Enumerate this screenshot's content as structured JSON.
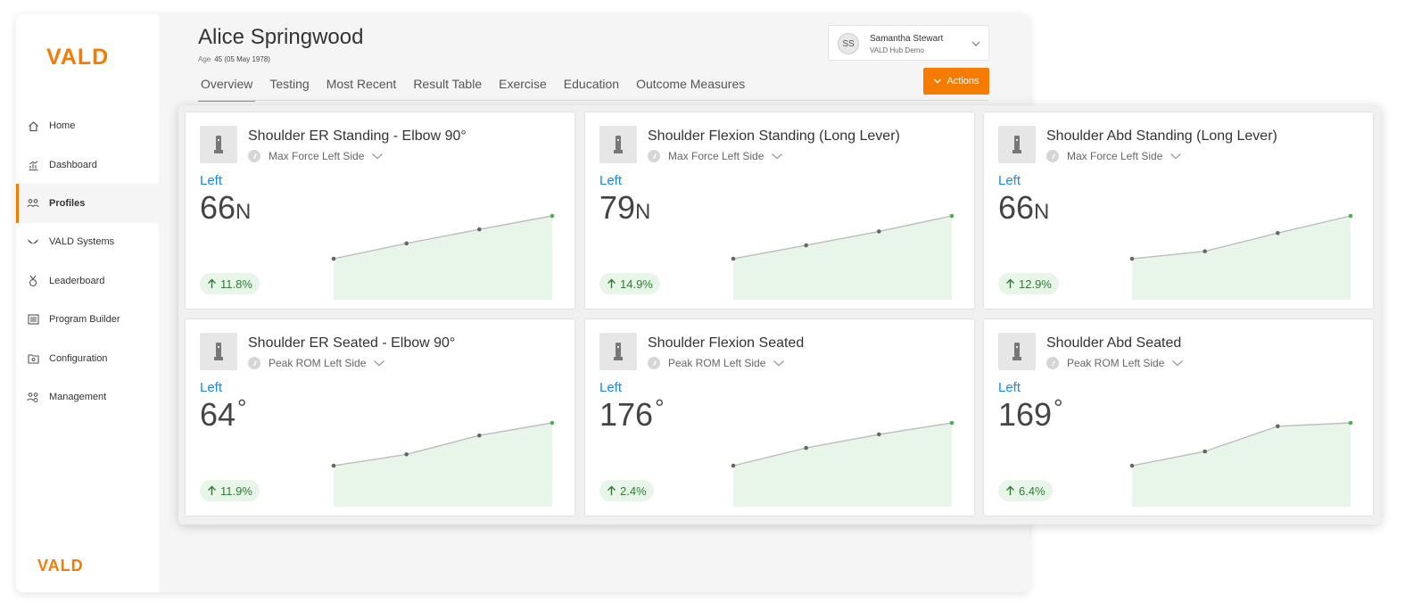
{
  "brand": {
    "top_logo": "VALD",
    "bottom_logo": "VALD",
    "accent": "#f57c00"
  },
  "sidebar": {
    "items": [
      {
        "label": "Home",
        "icon": "home-icon",
        "active": false
      },
      {
        "label": "Dashboard",
        "icon": "dashboard-icon",
        "active": false
      },
      {
        "label": "Profiles",
        "icon": "profiles-icon",
        "active": true
      },
      {
        "label": "VALD Systems",
        "icon": "systems-icon",
        "active": false
      },
      {
        "label": "Leaderboard",
        "icon": "medal-icon",
        "active": false
      },
      {
        "label": "Program Builder",
        "icon": "list-icon",
        "active": false
      },
      {
        "label": "Configuration",
        "icon": "folder-gear-icon",
        "active": false
      },
      {
        "label": "Management",
        "icon": "management-icon",
        "active": false
      }
    ]
  },
  "profile": {
    "name": "Alice Springwood",
    "age_label": "Age",
    "age_value": "45 (05 May 1978)"
  },
  "tabs": [
    {
      "label": "Overview",
      "active": true
    },
    {
      "label": "Testing",
      "active": false
    },
    {
      "label": "Most Recent",
      "active": false
    },
    {
      "label": "Result Table",
      "active": false
    },
    {
      "label": "Exercise",
      "active": false
    },
    {
      "label": "Education",
      "active": false
    },
    {
      "label": "Outcome Measures",
      "active": false
    }
  ],
  "user": {
    "initials": "SS",
    "name": "Samantha Stewart",
    "org": "VALD Hub Demo"
  },
  "actions": {
    "label": "Actions"
  },
  "colors": {
    "side_label": "#1e88e5",
    "trend_up": "#2e7d32",
    "trend_bg": "#e8f5e9",
    "spark_fill": "#e8f5e9",
    "spark_line": "#bdbdbd",
    "spark_last_point": "#4caf50"
  },
  "cards": [
    {
      "title": "Shoulder ER Standing - Elbow 90°",
      "metric": "Max Force Left Side",
      "side": "Left",
      "value": "66",
      "unit": "N",
      "change": "11.8%",
      "trend": [
        59.0,
        61.5,
        63.8,
        66.0
      ]
    },
    {
      "title": "Shoulder Flexion Standing (Long Lever)",
      "metric": "Max Force Left Side",
      "side": "Left",
      "value": "79",
      "unit": "N",
      "change": "14.9%",
      "trend": [
        68.8,
        72.0,
        75.3,
        79.0
      ]
    },
    {
      "title": "Shoulder Abd Standing (Long Lever)",
      "metric": "Max Force Left Side",
      "side": "Left",
      "value": "66",
      "unit": "N",
      "change": "12.9%",
      "trend": [
        58.5,
        59.8,
        63.0,
        66.0
      ]
    },
    {
      "title": "Shoulder ER Seated - Elbow 90°",
      "metric": "Peak ROM Left Side",
      "side": "Left",
      "value": "64",
      "unit": "°",
      "change": "11.9%",
      "trend": [
        57.2,
        59.0,
        62.0,
        64.0
      ]
    },
    {
      "title": "Shoulder Flexion Seated",
      "metric": "Peak ROM Left Side",
      "side": "Left",
      "value": "176",
      "unit": "°",
      "change": "2.4%",
      "trend": [
        171.9,
        173.6,
        174.9,
        176.0
      ]
    },
    {
      "title": "Shoulder Abd Seated",
      "metric": "Peak ROM Left Side",
      "side": "Left",
      "value": "169",
      "unit": "°",
      "change": "6.4%",
      "trend": [
        158.8,
        162.2,
        168.2,
        169.0
      ]
    }
  ]
}
